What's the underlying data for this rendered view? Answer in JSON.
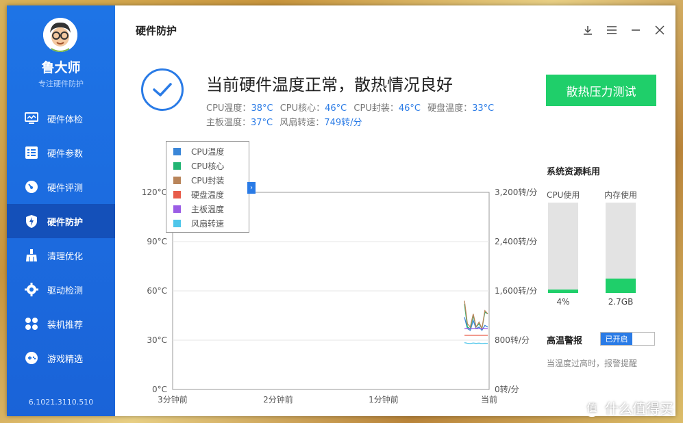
{
  "sidebar": {
    "brand_name": "鲁大师",
    "brand_tagline": "专注硬件防护",
    "items": [
      {
        "label": "硬件体检",
        "icon": "monitor-icon",
        "active": false
      },
      {
        "label": "硬件参数",
        "icon": "list-icon",
        "active": false
      },
      {
        "label": "硬件评测",
        "icon": "gauge-icon",
        "active": false
      },
      {
        "label": "硬件防护",
        "icon": "shield-bolt-icon",
        "active": true
      },
      {
        "label": "清理优化",
        "icon": "broom-icon",
        "active": false
      },
      {
        "label": "驱动检测",
        "icon": "gear-icon",
        "active": false
      },
      {
        "label": "装机推荐",
        "icon": "grid-icon",
        "active": false
      },
      {
        "label": "游戏精选",
        "icon": "gamepad-icon",
        "active": false
      }
    ],
    "version": "6.1021.3110.510"
  },
  "header": {
    "title": "硬件防护"
  },
  "status": {
    "title": "当前硬件温度正常，散热情况良好",
    "line1": [
      {
        "label": "CPU温度：",
        "value": "38°C"
      },
      {
        "label": "CPU核心：",
        "value": "46°C"
      },
      {
        "label": "CPU封装：",
        "value": "46°C"
      },
      {
        "label": "硬盘温度：",
        "value": "33°C"
      }
    ],
    "line2": [
      {
        "label": "主板温度：",
        "value": "37°C"
      },
      {
        "label": "风扇转速：",
        "value": "749转/分"
      }
    ]
  },
  "stress_button": "散热压力测试",
  "chart_data": {
    "type": "line",
    "left_axis_ticks": [
      "120°C",
      "90°C",
      "60°C",
      "30°C",
      "0°C"
    ],
    "right_axis_ticks": [
      "3,200转/分",
      "2,400转/分",
      "1,600转/分",
      "800转/分",
      "0转/分"
    ],
    "x_ticks": [
      "3分钟前",
      "2分钟前",
      "1分钟前",
      "当前"
    ],
    "left_ylim": [
      0,
      120
    ],
    "right_ylim": [
      0,
      3200
    ],
    "grid": true,
    "legend_position": "top-left",
    "series": [
      {
        "name": "CPU温度",
        "color": "#3a86d8",
        "axis": "left",
        "values": [
          44,
          37,
          36,
          42,
          37,
          38,
          36,
          39,
          38
        ]
      },
      {
        "name": "CPU核心",
        "color": "#22b573",
        "axis": "left",
        "values": [
          52,
          38,
          37,
          45,
          38,
          40,
          37,
          47,
          46
        ]
      },
      {
        "name": "CPU封装",
        "color": "#b9855a",
        "axis": "left",
        "values": [
          54,
          40,
          38,
          46,
          38,
          41,
          37,
          48,
          46
        ]
      },
      {
        "name": "硬盘温度",
        "color": "#e85c4a",
        "axis": "left",
        "values": [
          33,
          33,
          33,
          33,
          33,
          33,
          33,
          33,
          33
        ]
      },
      {
        "name": "主板温度",
        "color": "#9b5de5",
        "axis": "left",
        "values": [
          37,
          37,
          37,
          37,
          37,
          37,
          37,
          37,
          37
        ]
      },
      {
        "name": "风扇转速",
        "color": "#4fc6ea",
        "axis": "right",
        "values": [
          760,
          750,
          745,
          755,
          748,
          752,
          746,
          750,
          749
        ]
      }
    ]
  },
  "resources": {
    "title": "系统资源耗用",
    "cpu_label": "CPU使用",
    "cpu_value": "4%",
    "cpu_fraction": 0.04,
    "mem_label": "内存使用",
    "mem_value": "2.7GB",
    "mem_fraction": 0.16
  },
  "alarm": {
    "title": "高温警报",
    "toggle_label": "已开启",
    "description": "当温度过高时，报警提醒"
  },
  "watermark": {
    "symbol": "值",
    "text": "什么值得买"
  }
}
